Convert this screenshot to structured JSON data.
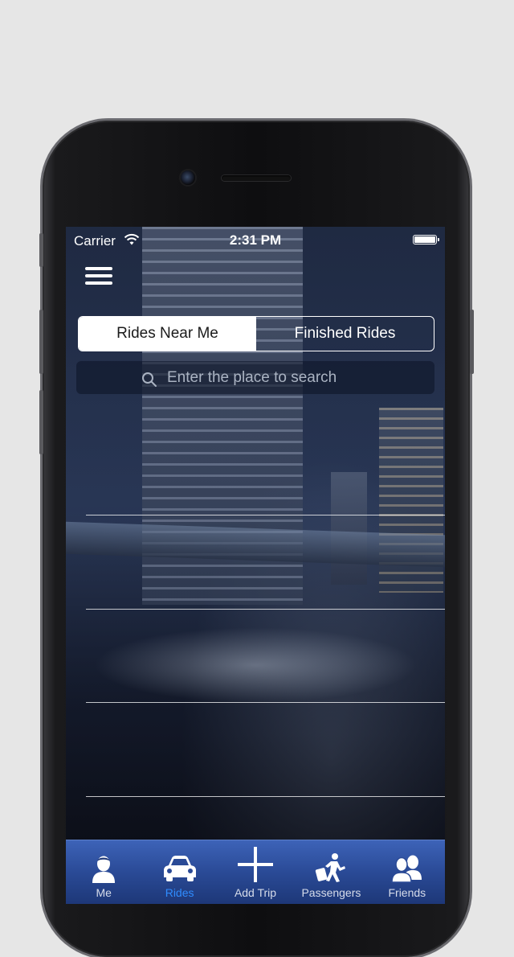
{
  "status_bar": {
    "carrier": "Carrier",
    "time": "2:31 PM"
  },
  "segmented": {
    "tabs": [
      {
        "label": "Rides Near Me",
        "selected": true
      },
      {
        "label": "Finished Rides",
        "selected": false
      }
    ]
  },
  "search": {
    "placeholder": "Enter the place to search",
    "value": ""
  },
  "tab_bar": {
    "items": [
      {
        "label": "Me",
        "icon": "person-icon",
        "active": false
      },
      {
        "label": "Rides",
        "icon": "car-icon",
        "active": true
      },
      {
        "label": "Add Trip",
        "icon": "plus-icon",
        "active": false
      },
      {
        "label": "Passengers",
        "icon": "traveler-icon",
        "active": false
      },
      {
        "label": "Friends",
        "icon": "friends-icon",
        "active": false
      }
    ]
  },
  "colors": {
    "tab_bar": "#2a4a96",
    "active_tab": "#2f8cff",
    "segment_active_bg": "#ffffff"
  }
}
